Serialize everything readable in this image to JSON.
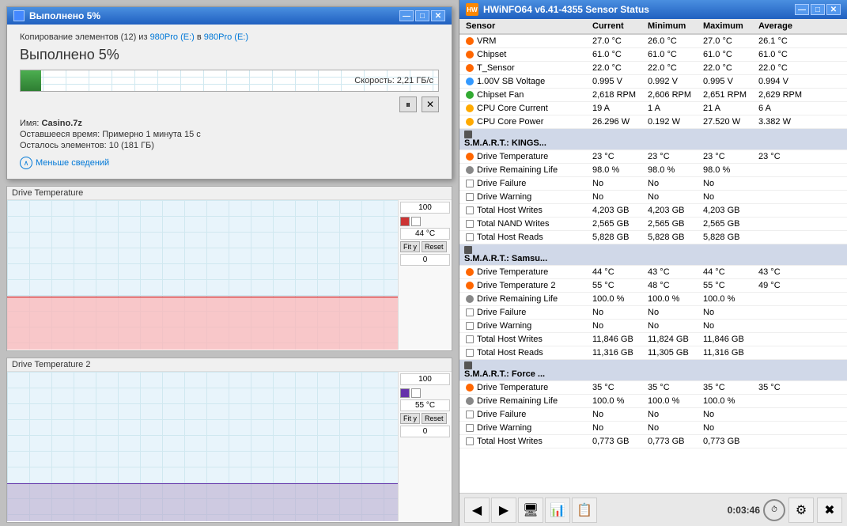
{
  "copy_dialog": {
    "title": "Выполнено 5%",
    "source_text": "Копирование элементов (12) из",
    "source_from": "980Pro (E:)",
    "source_to_text": "в",
    "source_to": "980Pro (E:)",
    "progress_label": "Выполнено 5%",
    "speed": "Скорость: 2,21 ГБ/с",
    "filename_label": "Имя:",
    "filename_value": "Casino.7z",
    "remaining_label": "Оставшееся время: Примерно 1 минута 15 с",
    "items_label": "Осталось элементов:",
    "items_value": "10 (181 ГБ)",
    "details_toggle": "Меньше сведений",
    "progress_pct": 5
  },
  "charts": [
    {
      "id": "chart1",
      "header": "Drive Temperature",
      "max_val": "100",
      "current_val": "44 °C",
      "min_val": "0",
      "fill_height": "35%",
      "line_pos": "35%"
    },
    {
      "id": "chart2",
      "header": "Drive Temperature 2",
      "max_val": "100",
      "current_val": "55 °C",
      "min_val": "0",
      "fill_height": "25%",
      "line_pos": "25%"
    }
  ],
  "hwinfo": {
    "title": "HWiNFO64 v6.41-4355 Sensor Status",
    "columns": [
      "Sensor",
      "Current",
      "Minimum",
      "Maximum",
      "Average"
    ],
    "sections": [
      {
        "type": "rows",
        "rows": [
          {
            "label": "VRM",
            "icon": "temp",
            "current": "27.0 °C",
            "minimum": "26.0 °C",
            "maximum": "27.0 °C",
            "average": "26.1 °C"
          },
          {
            "label": "Chipset",
            "icon": "temp",
            "current": "61.0 °C",
            "minimum": "61.0 °C",
            "maximum": "61.0 °C",
            "average": "61.0 °C"
          },
          {
            "label": "T_Sensor",
            "icon": "temp",
            "current": "22.0 °C",
            "minimum": "22.0 °C",
            "maximum": "22.0 °C",
            "average": "22.0 °C"
          },
          {
            "label": "1.00V SB Voltage",
            "icon": "voltage",
            "current": "0.995 V",
            "minimum": "0.992 V",
            "maximum": "0.995 V",
            "average": "0.994 V"
          },
          {
            "label": "Chipset Fan",
            "icon": "fan",
            "current": "2,618 RPM",
            "minimum": "2,606 RPM",
            "maximum": "2,651 RPM",
            "average": "2,629 RPM"
          },
          {
            "label": "CPU Core Current",
            "icon": "power",
            "current": "19 A",
            "minimum": "1 A",
            "maximum": "21 A",
            "average": "6 A"
          },
          {
            "label": "CPU Core Power",
            "icon": "power",
            "current": "26.296 W",
            "minimum": "0.192 W",
            "maximum": "27.520 W",
            "average": "3.382 W"
          }
        ]
      },
      {
        "type": "section",
        "label": "S.M.A.R.T.: KINGS...",
        "rows": [
          {
            "label": "Drive Temperature",
            "icon": "temp",
            "current": "23 °C",
            "minimum": "23 °C",
            "maximum": "23 °C",
            "average": "23 °C"
          },
          {
            "label": "Drive Remaining Life",
            "icon": "drive",
            "current": "98.0 %",
            "minimum": "98.0 %",
            "maximum": "98.0 %",
            "average": ""
          },
          {
            "label": "Drive Failure",
            "icon": "info",
            "current": "No",
            "minimum": "No",
            "maximum": "No",
            "average": ""
          },
          {
            "label": "Drive Warning",
            "icon": "info",
            "current": "No",
            "minimum": "No",
            "maximum": "No",
            "average": ""
          },
          {
            "label": "Total Host Writes",
            "icon": "info",
            "current": "4,203 GB",
            "minimum": "4,203 GB",
            "maximum": "4,203 GB",
            "average": ""
          },
          {
            "label": "Total NAND Writes",
            "icon": "info",
            "current": "2,565 GB",
            "minimum": "2,565 GB",
            "maximum": "2,565 GB",
            "average": ""
          },
          {
            "label": "Total Host Reads",
            "icon": "info",
            "current": "5,828 GB",
            "minimum": "5,828 GB",
            "maximum": "5,828 GB",
            "average": ""
          }
        ]
      },
      {
        "type": "section",
        "label": "S.M.A.R.T.: Samsu...",
        "rows": [
          {
            "label": "Drive Temperature",
            "icon": "temp",
            "current": "44 °C",
            "minimum": "43 °C",
            "maximum": "44 °C",
            "average": "43 °C"
          },
          {
            "label": "Drive Temperature 2",
            "icon": "temp",
            "current": "55 °C",
            "minimum": "48 °C",
            "maximum": "55 °C",
            "average": "49 °C"
          },
          {
            "label": "Drive Remaining Life",
            "icon": "drive",
            "current": "100.0 %",
            "minimum": "100.0 %",
            "maximum": "100.0 %",
            "average": ""
          },
          {
            "label": "Drive Failure",
            "icon": "info",
            "current": "No",
            "minimum": "No",
            "maximum": "No",
            "average": ""
          },
          {
            "label": "Drive Warning",
            "icon": "info",
            "current": "No",
            "minimum": "No",
            "maximum": "No",
            "average": ""
          },
          {
            "label": "Total Host Writes",
            "icon": "info",
            "current": "11,846 GB",
            "minimum": "11,824 GB",
            "maximum": "11,846 GB",
            "average": ""
          },
          {
            "label": "Total Host Reads",
            "icon": "info",
            "current": "11,316 GB",
            "minimum": "11,305 GB",
            "maximum": "11,316 GB",
            "average": ""
          }
        ]
      },
      {
        "type": "section",
        "label": "S.M.A.R.T.: Force ...",
        "rows": [
          {
            "label": "Drive Temperature",
            "icon": "temp",
            "current": "35 °C",
            "minimum": "35 °C",
            "maximum": "35 °C",
            "average": "35 °C"
          },
          {
            "label": "Drive Remaining Life",
            "icon": "drive",
            "current": "100.0 %",
            "minimum": "100.0 %",
            "maximum": "100.0 %",
            "average": ""
          },
          {
            "label": "Drive Failure",
            "icon": "info",
            "current": "No",
            "minimum": "No",
            "maximum": "No",
            "average": ""
          },
          {
            "label": "Drive Warning",
            "icon": "info",
            "current": "No",
            "minimum": "No",
            "maximum": "No",
            "average": ""
          },
          {
            "label": "Total Host Writes",
            "icon": "info",
            "current": "0,773 GB",
            "minimum": "0,773 GB",
            "maximum": "0,773 GB",
            "average": ""
          }
        ]
      }
    ],
    "taskbar": {
      "time": "0:03:46",
      "buttons": [
        "◀",
        "▶",
        "🖥",
        "📊",
        "📋",
        "⚙",
        "✖"
      ]
    }
  }
}
